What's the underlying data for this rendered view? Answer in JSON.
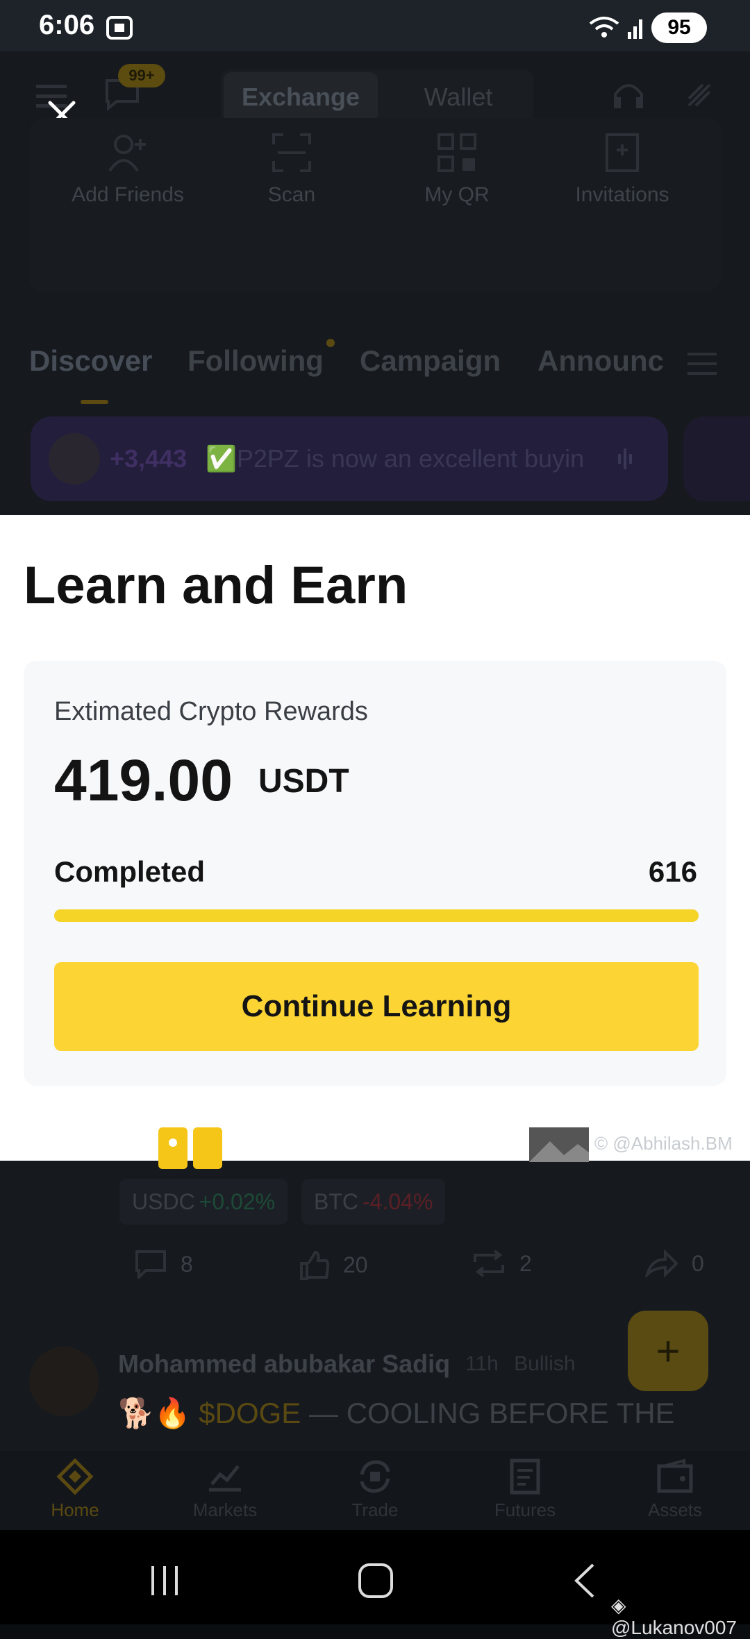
{
  "status_bar": {
    "time": "6:06",
    "battery": "95"
  },
  "background": {
    "header_badge": "99+",
    "tabs": [
      "Exchange",
      "Wallet"
    ],
    "quick_actions": [
      "Add Friends",
      "Scan",
      "My QR",
      "Invitations"
    ],
    "feed_tabs": [
      "Discover",
      "Following",
      "Campaign",
      "Announc"
    ],
    "promo": {
      "count": "+3,443",
      "text": "✅P2PZ is now an excellent buyin"
    },
    "chips": [
      {
        "symbol": "USDC",
        "change": "+0.02%"
      },
      {
        "symbol": "BTC",
        "change": "-4.04%"
      }
    ],
    "actions": {
      "comments": "8",
      "likes": "20",
      "reposts": "2",
      "shares": "0"
    },
    "fab": "+",
    "post": {
      "author": "Mohammed abubakar Sadiq",
      "time": "11h",
      "tag": "Bullish",
      "emoji": "🐕🔥",
      "token": "$DOGE",
      "text": " — COOLING BEFORE THE"
    },
    "bottom_nav": [
      "Home",
      "Markets",
      "Trade",
      "Futures",
      "Assets"
    ]
  },
  "sheet": {
    "title": "Learn and Earn",
    "rewards_label": "Extimated Crypto Rewards",
    "amount": "419.00",
    "unit": "USDT",
    "completed_label": "Completed",
    "completed_count": "616",
    "progress_fraction": 1.0,
    "cta": "Continue Learning",
    "watermark": "© @Abhilash.BM"
  },
  "watermark_bottom": "@Lukanov007",
  "colors": {
    "brand_yellow": "#fcd535",
    "background": "#0b0e11",
    "sheet": "#ffffff"
  }
}
